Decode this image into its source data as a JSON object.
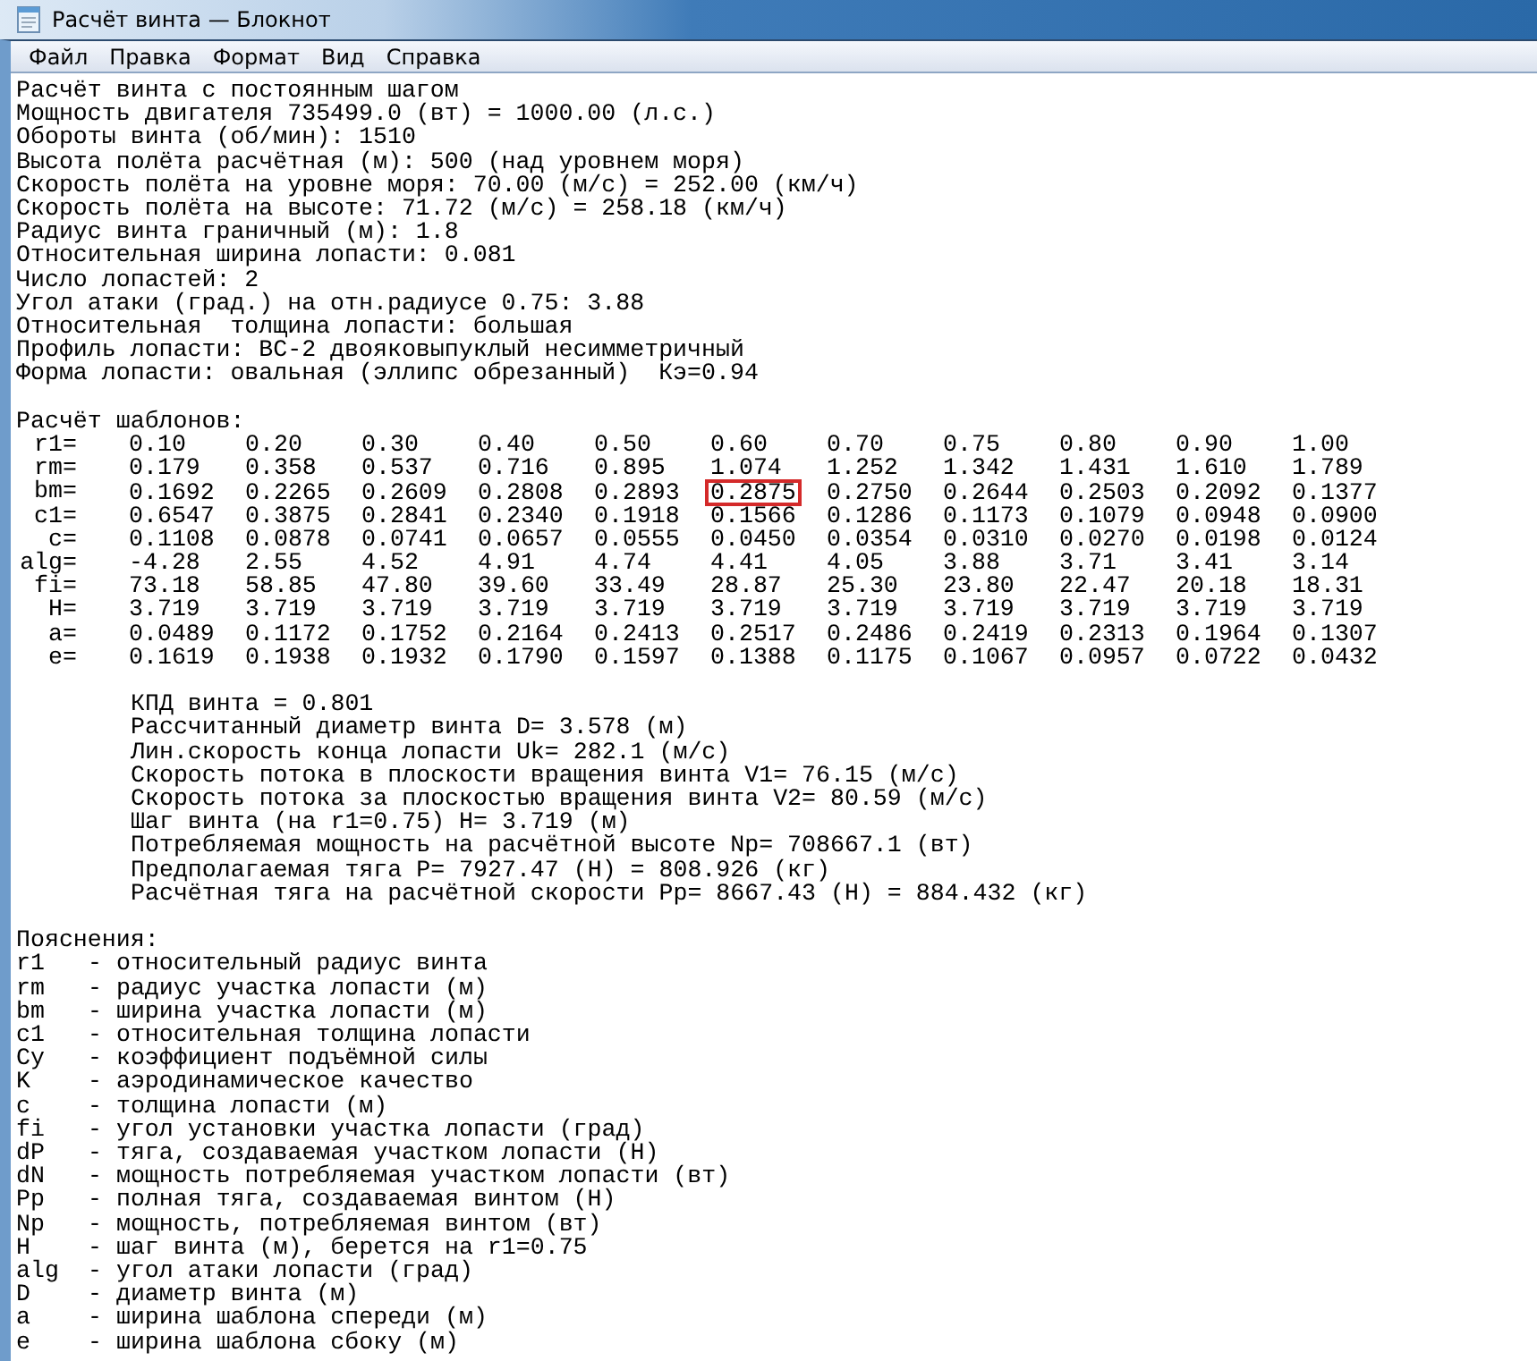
{
  "window": {
    "title": "Расчёт винта — Блокнот"
  },
  "menu": [
    "Файл",
    "Правка",
    "Формат",
    "Вид",
    "Справка"
  ],
  "header_lines": [
    "Расчёт винта с постоянным шагом",
    "Мощность двигателя 735499.0 (вт) = 1000.00 (л.с.)",
    "Обороты винта (об/мин): 1510",
    "Высота полёта расчётная (м): 500 (над уровнем моря)",
    "Скорость полёта на уровне моря: 70.00 (м/с) = 252.00 (км/ч)",
    "Скорость полёта на высоте: 71.72 (м/с) = 258.18 (км/ч)",
    "Радиус винта граничный (м): 1.8",
    "Относительная ширина лопасти: 0.081",
    "Число лопастей: 2",
    "Угол атаки (град.) на отн.радиусе 0.75: 3.88",
    "Относительная  толщина лопасти: большая",
    "Профиль лопасти: ВС-2 двояковыпуклый несимметричный",
    "Форма лопасти: овальная (эллипс обрезанный)  Кэ=0.94"
  ],
  "templates_title": "Расчёт шаблонов:",
  "table": [
    {
      "label": "r1=",
      "cells": [
        {
          "v": "0.10",
          "marked": false
        },
        {
          "v": "0.20",
          "marked": false
        },
        {
          "v": "0.30",
          "marked": false
        },
        {
          "v": "0.40",
          "marked": false
        },
        {
          "v": "0.50",
          "marked": false
        },
        {
          "v": "0.60",
          "marked": false
        },
        {
          "v": "0.70",
          "marked": false
        },
        {
          "v": "0.75",
          "marked": false
        },
        {
          "v": "0.80",
          "marked": false
        },
        {
          "v": "0.90",
          "marked": false
        },
        {
          "v": "1.00",
          "marked": false
        }
      ]
    },
    {
      "label": "rm=",
      "cells": [
        {
          "v": "0.179",
          "marked": false
        },
        {
          "v": "0.358",
          "marked": false
        },
        {
          "v": "0.537",
          "marked": false
        },
        {
          "v": "0.716",
          "marked": false
        },
        {
          "v": "0.895",
          "marked": false
        },
        {
          "v": "1.074",
          "marked": false
        },
        {
          "v": "1.252",
          "marked": false
        },
        {
          "v": "1.342",
          "marked": false
        },
        {
          "v": "1.431",
          "marked": false
        },
        {
          "v": "1.610",
          "marked": false
        },
        {
          "v": "1.789",
          "marked": false
        }
      ]
    },
    {
      "label": "bm=",
      "cells": [
        {
          "v": "0.1692",
          "marked": false
        },
        {
          "v": "0.2265",
          "marked": false
        },
        {
          "v": "0.2609",
          "marked": false
        },
        {
          "v": "0.2808",
          "marked": false
        },
        {
          "v": "0.2893",
          "marked": false
        },
        {
          "v": "0.2875",
          "marked": true
        },
        {
          "v": "0.2750",
          "marked": false
        },
        {
          "v": "0.2644",
          "marked": false
        },
        {
          "v": "0.2503",
          "marked": false
        },
        {
          "v": "0.2092",
          "marked": false
        },
        {
          "v": "0.1377",
          "marked": false
        }
      ]
    },
    {
      "label": "c1=",
      "cells": [
        {
          "v": "0.6547",
          "marked": false
        },
        {
          "v": "0.3875",
          "marked": false
        },
        {
          "v": "0.2841",
          "marked": false
        },
        {
          "v": "0.2340",
          "marked": false
        },
        {
          "v": "0.1918",
          "marked": false
        },
        {
          "v": "0.1566",
          "marked": false
        },
        {
          "v": "0.1286",
          "marked": false
        },
        {
          "v": "0.1173",
          "marked": false
        },
        {
          "v": "0.1079",
          "marked": false
        },
        {
          "v": "0.0948",
          "marked": false
        },
        {
          "v": "0.0900",
          "marked": false
        }
      ]
    },
    {
      "label": "c=",
      "cells": [
        {
          "v": "0.1108",
          "marked": false
        },
        {
          "v": "0.0878",
          "marked": false
        },
        {
          "v": "0.0741",
          "marked": false
        },
        {
          "v": "0.0657",
          "marked": false
        },
        {
          "v": "0.0555",
          "marked": false
        },
        {
          "v": "0.0450",
          "marked": false
        },
        {
          "v": "0.0354",
          "marked": false
        },
        {
          "v": "0.0310",
          "marked": false
        },
        {
          "v": "0.0270",
          "marked": false
        },
        {
          "v": "0.0198",
          "marked": false
        },
        {
          "v": "0.0124",
          "marked": false
        }
      ]
    },
    {
      "label": "alg=",
      "cells": [
        {
          "v": "-4.28",
          "marked": false
        },
        {
          "v": "2.55",
          "marked": false
        },
        {
          "v": "4.52",
          "marked": false
        },
        {
          "v": "4.91",
          "marked": false
        },
        {
          "v": "4.74",
          "marked": false
        },
        {
          "v": "4.41",
          "marked": false
        },
        {
          "v": "4.05",
          "marked": false
        },
        {
          "v": "3.88",
          "marked": false
        },
        {
          "v": "3.71",
          "marked": false
        },
        {
          "v": "3.41",
          "marked": false
        },
        {
          "v": "3.14",
          "marked": false
        }
      ]
    },
    {
      "label": "fi=",
      "cells": [
        {
          "v": "73.18",
          "marked": false
        },
        {
          "v": "58.85",
          "marked": false
        },
        {
          "v": "47.80",
          "marked": false
        },
        {
          "v": "39.60",
          "marked": false
        },
        {
          "v": "33.49",
          "marked": false
        },
        {
          "v": "28.87",
          "marked": false
        },
        {
          "v": "25.30",
          "marked": false
        },
        {
          "v": "23.80",
          "marked": false
        },
        {
          "v": "22.47",
          "marked": false
        },
        {
          "v": "20.18",
          "marked": false
        },
        {
          "v": "18.31",
          "marked": false
        }
      ]
    },
    {
      "label": "H=",
      "cells": [
        {
          "v": "3.719",
          "marked": false
        },
        {
          "v": "3.719",
          "marked": false
        },
        {
          "v": "3.719",
          "marked": false
        },
        {
          "v": "3.719",
          "marked": false
        },
        {
          "v": "3.719",
          "marked": false
        },
        {
          "v": "3.719",
          "marked": false
        },
        {
          "v": "3.719",
          "marked": false
        },
        {
          "v": "3.719",
          "marked": false
        },
        {
          "v": "3.719",
          "marked": false
        },
        {
          "v": "3.719",
          "marked": false
        },
        {
          "v": "3.719",
          "marked": false
        }
      ]
    },
    {
      "label": "a=",
      "cells": [
        {
          "v": "0.0489",
          "marked": false
        },
        {
          "v": "0.1172",
          "marked": false
        },
        {
          "v": "0.1752",
          "marked": false
        },
        {
          "v": "0.2164",
          "marked": false
        },
        {
          "v": "0.2413",
          "marked": false
        },
        {
          "v": "0.2517",
          "marked": false
        },
        {
          "v": "0.2486",
          "marked": false
        },
        {
          "v": "0.2419",
          "marked": false
        },
        {
          "v": "0.2313",
          "marked": false
        },
        {
          "v": "0.1964",
          "marked": false
        },
        {
          "v": "0.1307",
          "marked": false
        }
      ]
    },
    {
      "label": "e=",
      "cells": [
        {
          "v": "0.1619",
          "marked": false
        },
        {
          "v": "0.1938",
          "marked": false
        },
        {
          "v": "0.1932",
          "marked": false
        },
        {
          "v": "0.1790",
          "marked": false
        },
        {
          "v": "0.1597",
          "marked": false
        },
        {
          "v": "0.1388",
          "marked": false
        },
        {
          "v": "0.1175",
          "marked": false
        },
        {
          "v": "0.1067",
          "marked": false
        },
        {
          "v": "0.0957",
          "marked": false
        },
        {
          "v": "0.0722",
          "marked": false
        },
        {
          "v": "0.0432",
          "marked": false
        }
      ]
    }
  ],
  "results": [
    "КПД винта = 0.801",
    "Рассчитанный диаметр винта D= 3.578 (м)",
    "Лин.скорость конца лопасти Uk= 282.1 (м/с)",
    "Скорость потока в плоскости вращения винта V1= 76.15 (м/с)",
    "Скорость потока за плоскостью вращения винта V2= 80.59 (м/с)",
    "Шаг винта (на r1=0.75) H= 3.719 (м)",
    "Потребляемая мощность на расчётной высоте Np= 708667.1 (вт)",
    "Предполагаемая тяга P= 7927.47 (Н) = 808.926 (кг)",
    "Расчётная тяга на расчётной скорости Pp= 8667.43 (Н) = 884.432 (кг)"
  ],
  "notes_title": "Пояснения:",
  "notes": [
    {
      "term": "r1",
      "text": "- относительный радиус винта"
    },
    {
      "term": "rm",
      "text": "- радиус участка лопасти (м)"
    },
    {
      "term": "bm",
      "text": "- ширина участка лопасти (м)"
    },
    {
      "term": "c1",
      "text": "- относительная толщина лопасти"
    },
    {
      "term": "Cy",
      "text": "- коэффициент подъёмной силы"
    },
    {
      "term": "K",
      "text": "- аэродинамическое качество"
    },
    {
      "term": "c",
      "text": "- толщина лопасти (м)"
    },
    {
      "term": "fi",
      "text": "- угол установки участка лопасти (град)"
    },
    {
      "term": "dP",
      "text": "- тяга, создаваемая участком лопасти (Н)"
    },
    {
      "term": "dN",
      "text": "- мощность потребляемая участком лопасти (вт)"
    },
    {
      "term": "Pp",
      "text": "- полная тяга, создаваемая винтом (Н)"
    },
    {
      "term": "Np",
      "text": "- мощность, потребляемая винтом (вт)"
    },
    {
      "term": "H",
      "text": "- шаг винта (м), берется на r1=0.75"
    },
    {
      "term": "alg",
      "text": "- угол атаки лопасти (град)"
    },
    {
      "term": "D",
      "text": "- диаметр винта (м)"
    },
    {
      "term": "a",
      "text": "- ширина шаблона спереди (м)"
    },
    {
      "term": "e",
      "text": "- ширина шаблона сбоку (м)"
    }
  ]
}
